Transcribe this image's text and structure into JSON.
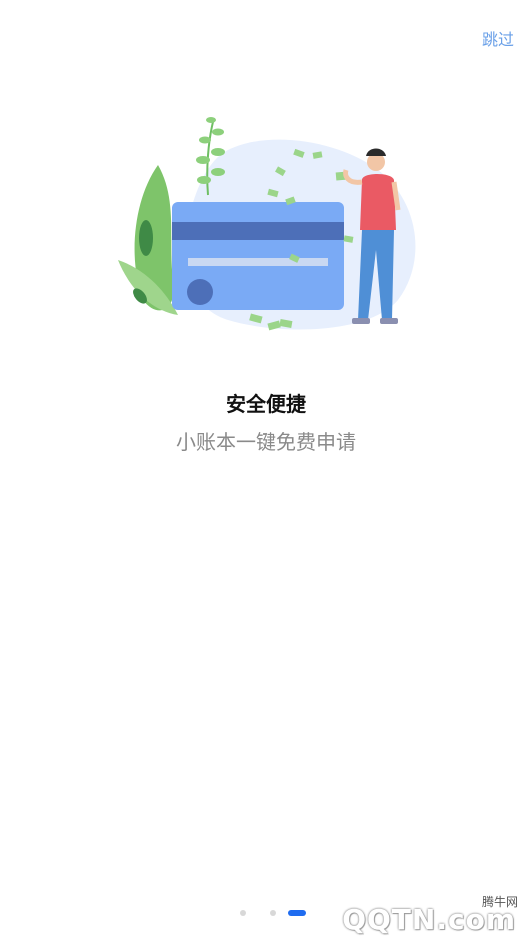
{
  "header": {
    "skip_label": "跳过"
  },
  "slide": {
    "title": "安全便捷",
    "subtitle": "小账本一键免费申请",
    "illustration": "credit-card-with-person-illustration"
  },
  "pagination": {
    "count": 3,
    "active_index": 2
  },
  "watermark": {
    "site_name": "腾牛网",
    "logo_text": "QQTN.com"
  },
  "colors": {
    "accent": "#1f6cf0",
    "skip_text": "#6aa0e8",
    "card": "#7aaaf5",
    "card_stripe": "#4d6fb8"
  }
}
